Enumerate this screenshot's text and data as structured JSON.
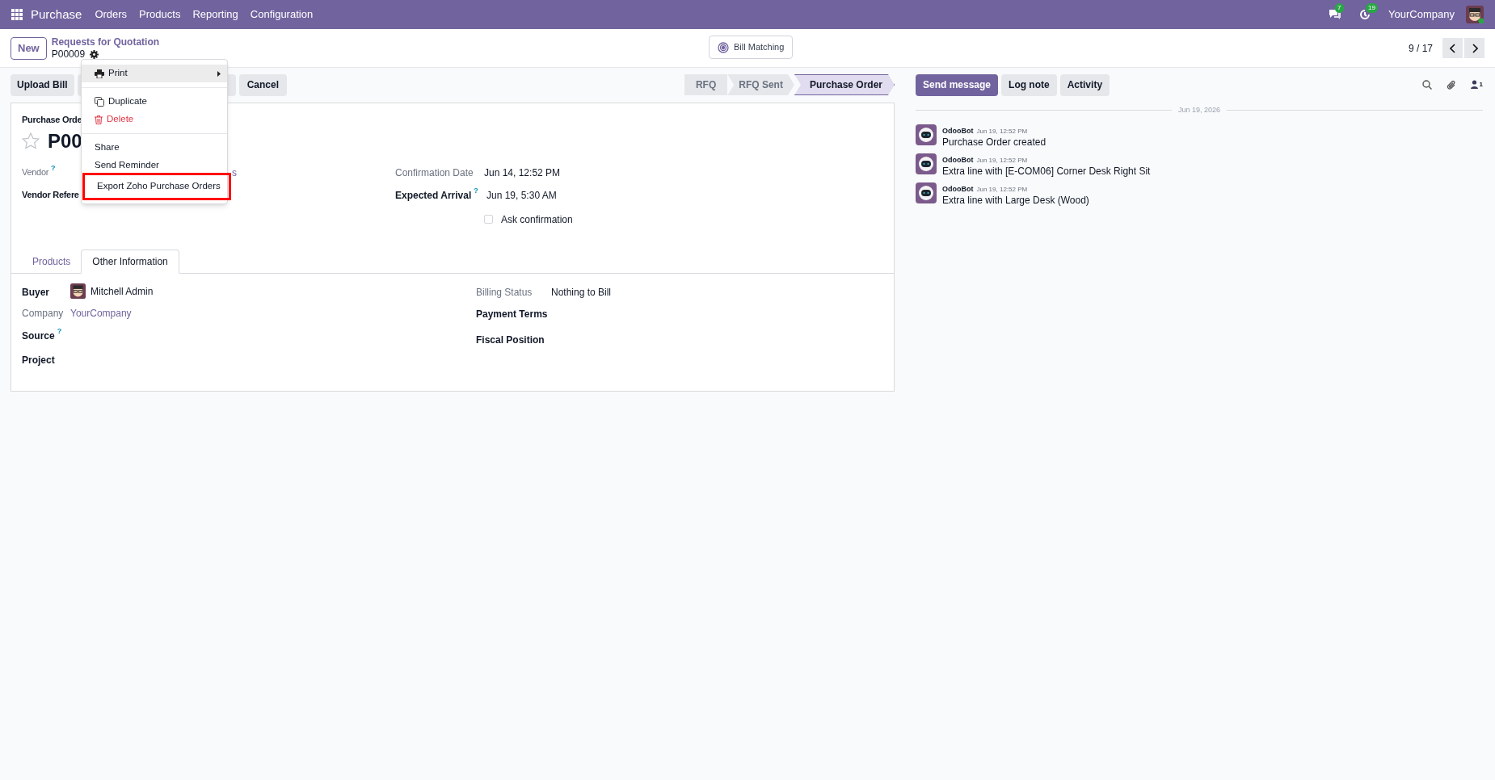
{
  "navbar": {
    "app": "Purchase",
    "menu": [
      "Orders",
      "Products",
      "Reporting",
      "Configuration"
    ],
    "messages_badge": "7",
    "activities_badge": "19",
    "company": "YourCompany"
  },
  "control_panel": {
    "new_button": "New",
    "breadcrumb": "Requests for Quotation",
    "record": "P00009",
    "smart_button": "Bill Matching",
    "pager": "9 / 17"
  },
  "actions": {
    "buttons": [
      "Upload Bill",
      "Cancel"
    ],
    "statusbar": [
      {
        "label": "RFQ",
        "selected": false
      },
      {
        "label": "RFQ Sent",
        "selected": false
      },
      {
        "label": "Purchase Order",
        "selected": true
      }
    ]
  },
  "dropdown": {
    "items": [
      {
        "kind": "submenu",
        "label": "Print",
        "highlighted": true
      },
      {
        "kind": "separator"
      },
      {
        "kind": "duplicate",
        "label": "Duplicate"
      },
      {
        "kind": "delete",
        "label": "Delete"
      },
      {
        "kind": "separator"
      },
      {
        "kind": "plain",
        "label": "Share"
      },
      {
        "kind": "plain",
        "label": "Send Reminder"
      },
      {
        "kind": "plain",
        "label": "Export Zoho Purchase Orders",
        "outlined": true
      }
    ]
  },
  "form": {
    "subtitle": "Purchase Orde",
    "name": "P00",
    "left_fields": [
      {
        "label": "Vendor",
        "bold": false,
        "help": "?",
        "value": "s"
      },
      {
        "label": "Vendor Refere",
        "bold": true
      }
    ],
    "right_fields": [
      {
        "label": "Confirmation Date",
        "bold": false,
        "value": "Jun 14, 12:52 PM"
      },
      {
        "label": "Expected Arrival",
        "bold": true,
        "help": "?",
        "value": "Jun 19, 5:30 AM"
      }
    ],
    "ask_confirmation": {
      "label": "Ask confirmation",
      "checked": false
    },
    "tabs": [
      {
        "label": "Products",
        "selected": false
      },
      {
        "label": "Other Information",
        "selected": true
      }
    ],
    "other_left": [
      {
        "label": "Buyer",
        "bold": true,
        "value": "Mitchell Admin",
        "kind": "user"
      },
      {
        "label": "Company",
        "bold": false,
        "value": "YourCompany",
        "kind": "link"
      },
      {
        "label": "Source",
        "bold": true,
        "help": "?"
      },
      {
        "label": "Project",
        "bold": true
      }
    ],
    "other_right": [
      {
        "label": "Billing Status",
        "bold": false,
        "value": "Nothing to Bill",
        "kind": "text"
      },
      {
        "label": "Payment Terms",
        "bold": true
      },
      {
        "label": "Fiscal Position",
        "bold": true
      }
    ]
  },
  "chatter": {
    "buttons": [
      {
        "label": "Send message",
        "selected": true
      },
      {
        "label": "Log note",
        "selected": false
      },
      {
        "label": "Activity",
        "selected": false
      }
    ],
    "followers": "1",
    "date": "Jun 19, 2026",
    "messages": [
      {
        "author": "OdooBot",
        "time": "Jun 19, 12:52 PM",
        "body": "Purchase Order created"
      },
      {
        "author": "OdooBot",
        "time": "Jun 19, 12:52 PM",
        "body": "Extra line with [E-COM06] Corner Desk Right Sit"
      },
      {
        "author": "OdooBot",
        "time": "Jun 19, 12:52 PM",
        "body": "Extra line with Large Desk (Wood)"
      }
    ]
  }
}
